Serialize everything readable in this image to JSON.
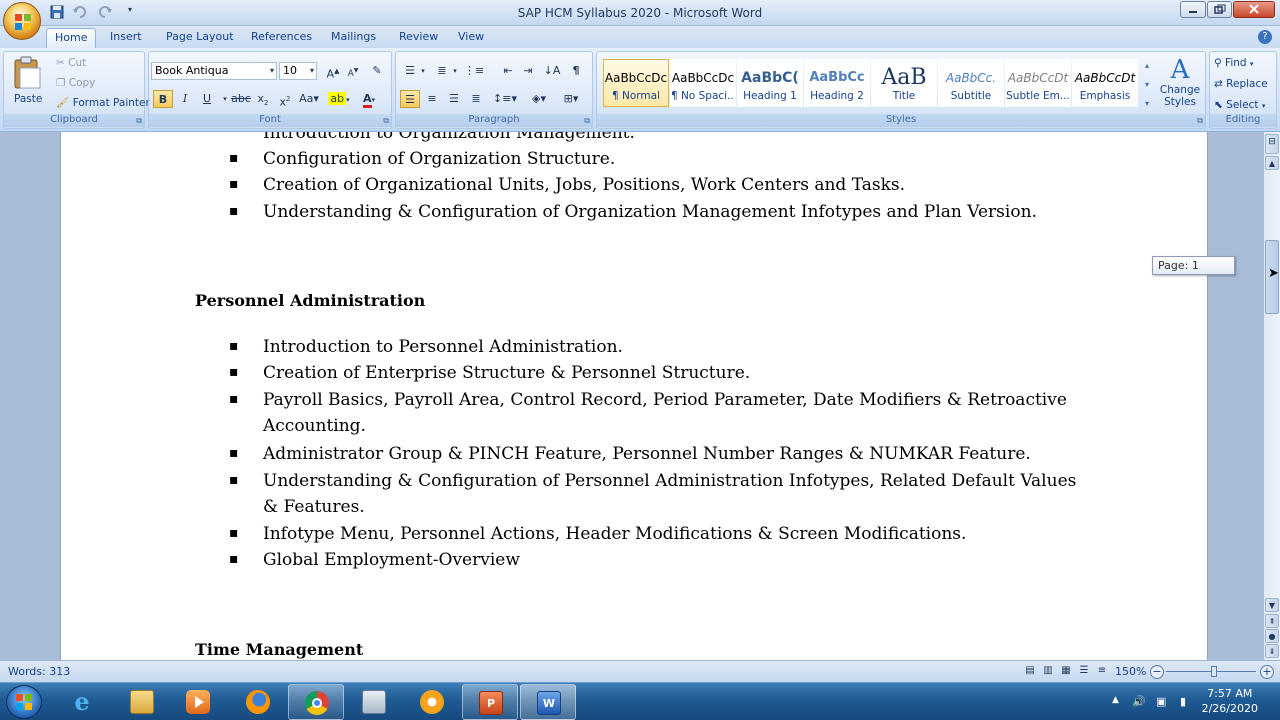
{
  "window": {
    "title": "SAP HCM Syllabus 2020 - Microsoft Word"
  },
  "tabs": [
    "Home",
    "Insert",
    "Page Layout",
    "References",
    "Mailings",
    "Review",
    "View"
  ],
  "active_tab": "Home",
  "ribbon": {
    "clipboard": {
      "paste": "Paste",
      "cut": "Cut",
      "copy": "Copy",
      "format_painter": "Format Painter",
      "label": "Clipboard"
    },
    "font": {
      "family": "Book Antiqua",
      "size": "10",
      "label": "Font"
    },
    "paragraph": {
      "label": "Paragraph"
    },
    "styles": {
      "label": "Styles",
      "items": [
        {
          "preview": "AaBbCcDc",
          "name": "¶ Normal"
        },
        {
          "preview": "AaBbCcDc",
          "name": "¶ No Spaci..."
        },
        {
          "preview": "AaBbC(",
          "name": "Heading 1"
        },
        {
          "preview": "AaBbCc",
          "name": "Heading 2"
        },
        {
          "preview": "AaB",
          "name": "Title"
        },
        {
          "preview": "AaBbCc.",
          "name": "Subtitle"
        },
        {
          "preview": "AaBbCcDt",
          "name": "Subtle Em..."
        },
        {
          "preview": "AaBbCcDt",
          "name": "Emphasis"
        }
      ],
      "change_styles": "Change Styles"
    },
    "editing": {
      "find": "Find",
      "replace": "Replace",
      "select": "Select",
      "label": "Editing"
    }
  },
  "document": {
    "partial_top_line": "Introduction to Organization Management.",
    "org_items": [
      "Configuration of Organization Structure.",
      "Creation of Organizational Units, Jobs, Positions, Work Centers and Tasks.",
      "Understanding & Configuration of Organization Management Infotypes and Plan Version."
    ],
    "pa_heading": "Personnel Administration",
    "pa_lines": [
      "Introduction to Personnel Administration.",
      "Creation of Enterprise Structure & Personnel Structure.",
      "Payroll Basics, Payroll Area, Control Record, Period Parameter, Date Modifiers & Retroactive",
      "Accounting.",
      "Administrator Group & PINCH Feature, Personnel Number Ranges & NUMKAR Feature.",
      "Understanding & Configuration of Personnel Administration Infotypes, Related Default Values",
      "& Features.",
      "Infotype Menu, Personnel Actions, Header Modifications & Screen Modifications.",
      "Global Employment-Overview"
    ],
    "tm_heading": "Time Management"
  },
  "page_tooltip": "Page: 1",
  "status": {
    "words": "Words: 313",
    "zoom": "150%"
  },
  "taskbar": {
    "time": "7:57 AM",
    "date": "2/26/2020"
  },
  "colors": {
    "ribbon_text": "#15428b",
    "taskbar": "#1f5a93"
  }
}
